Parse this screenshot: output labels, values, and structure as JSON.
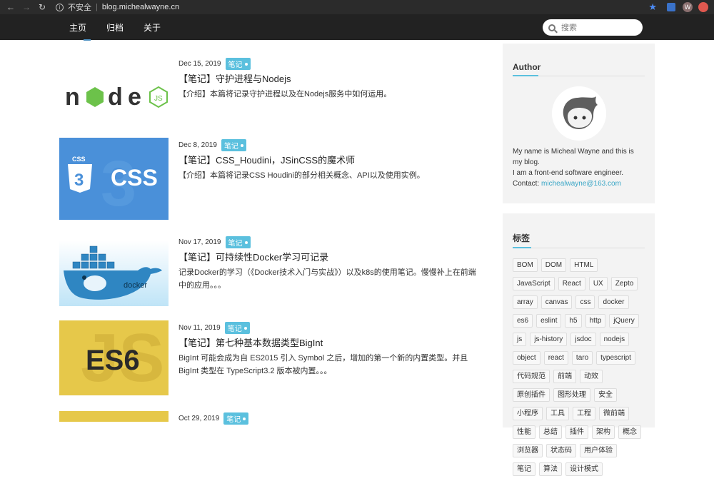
{
  "browser": {
    "insecure_label": "不安全",
    "url": "blog.micheal wayne.cn",
    "profile_initial": "W"
  },
  "nav": {
    "items": [
      "主页",
      "归档",
      "关于"
    ],
    "search_placeholder": "搜索"
  },
  "posts": [
    {
      "date": "Dec 15, 2019",
      "badge": "笔记",
      "title": "【笔记】守护进程与Nodejs",
      "desc": "【介绍】本篇将记录守护进程以及在Nodejs服务中如何运用。",
      "thumb": "nodejs-logo"
    },
    {
      "date": "Dec 8, 2019",
      "badge": "笔记",
      "title": "【笔记】CSS_Houdini，JSinCSS的魔术师",
      "desc": "【介绍】本篇将记录CSS Houdini的部分相关概念、API以及使用实例。",
      "thumb": "css-logo"
    },
    {
      "date": "Nov 17, 2019",
      "badge": "笔记",
      "title": "【笔记】可持续性Docker学习可记录",
      "desc": "记录Docker的学习（《Docker技术入门与实战》）以及k8s的使用笔记。慢慢补上在前端中的应用。。。",
      "thumb": "docker-logo"
    },
    {
      "date": "Nov 11, 2019",
      "badge": "笔记",
      "title": "【笔记】第七种基本数据类型BigInt",
      "desc": "BigInt 可能会成为自 ES2015 引入 Symbol 之后，增加的第一个新的内置类型。并且 BigInt 类型在 TypeScript3.2 版本被内置。。。",
      "thumb": "es6-logo"
    },
    {
      "date": "Oct 29, 2019",
      "badge": "笔记",
      "title": "",
      "desc": "",
      "thumb": "js-logo"
    }
  ],
  "author": {
    "heading": "Author",
    "bio_line1": "My name is Micheal Wayne and this is my blog.",
    "bio_line2": "I am a front-end software engineer.",
    "contact_label": "Contact: ",
    "email": "michealwayne@163.com"
  },
  "tags_section": {
    "heading": "标签",
    "tags": [
      "BOM",
      "DOM",
      "HTML",
      "JavaScript",
      "React",
      "UX",
      "Zepto",
      "array",
      "canvas",
      "css",
      "docker",
      "es6",
      "eslint",
      "h5",
      "http",
      "jQuery",
      "js",
      "js-history",
      "jsdoc",
      "nodejs",
      "object",
      "react",
      "taro",
      "typescript",
      "代码规范",
      "前端",
      "动效",
      "原创插件",
      "图形处理",
      "安全",
      "小程序",
      "工具",
      "工程",
      "微前端",
      "性能",
      "总结",
      "插件",
      "架构",
      "概念",
      "浏览器",
      "状态码",
      "用户体验",
      "笔记",
      "算法",
      "设计模式"
    ]
  },
  "colors": {
    "nav_bg": "#222222",
    "badge": "#5bc0de",
    "sidebar_bg": "#f3f3f3",
    "css_blue": "#4a90d9",
    "js_yellow": "#e6c84a"
  }
}
